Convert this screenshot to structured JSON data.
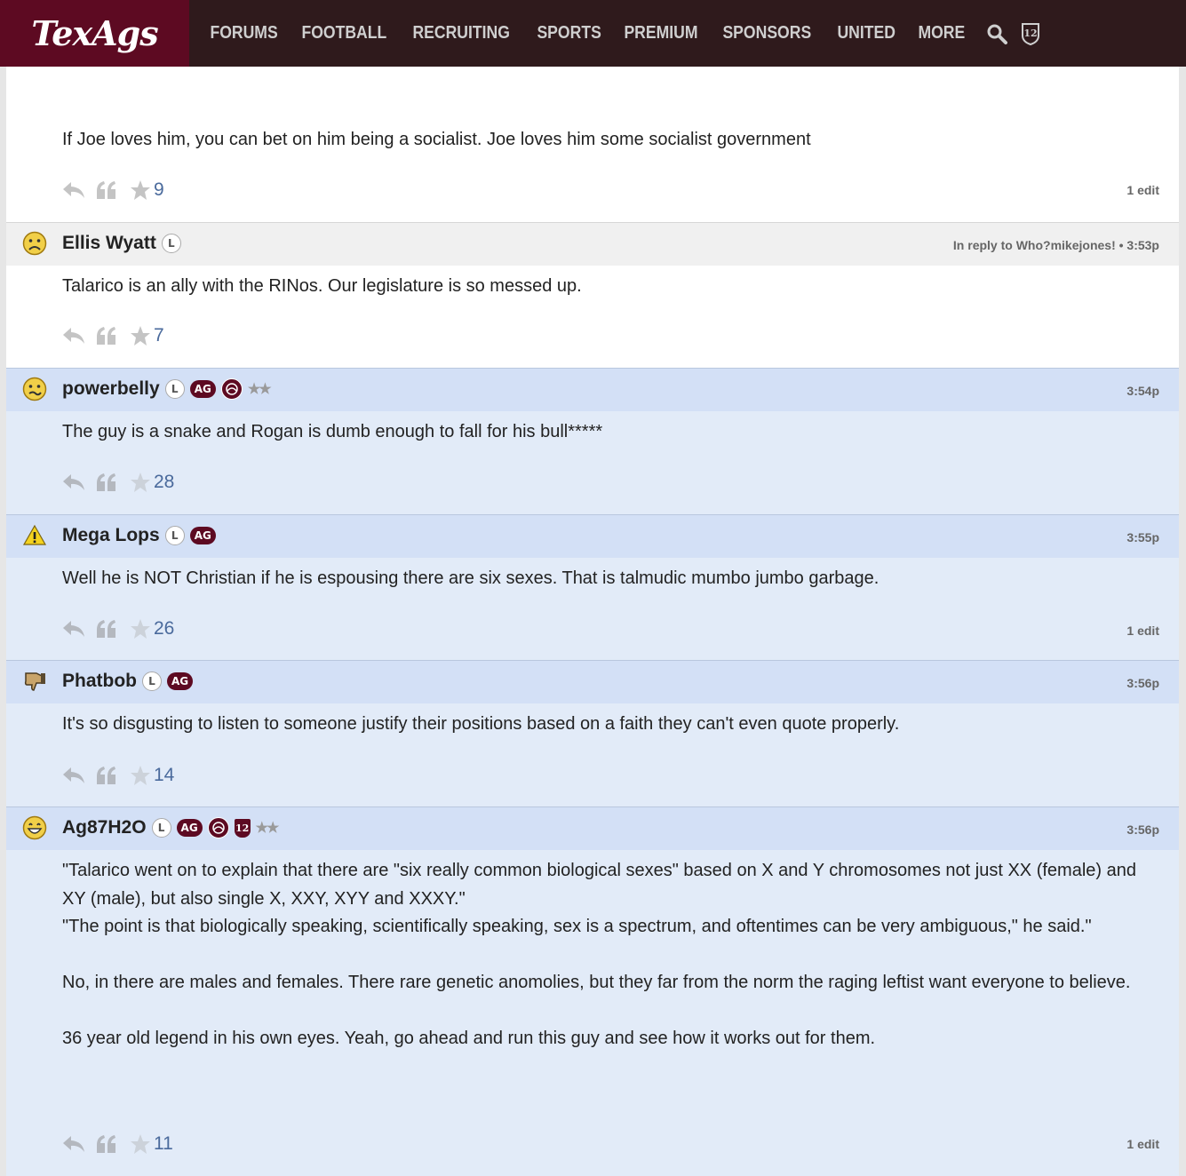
{
  "site": {
    "logo": "TexAgs"
  },
  "nav": {
    "items": [
      "FORUMS",
      "FOOTBALL",
      "RECRUITING",
      "SPORTS",
      "PREMIUM",
      "SPONSORS",
      "UNITED",
      "MORE"
    ],
    "twelfth_man_badge": "12"
  },
  "colors": {
    "maroon": "#5d0a22",
    "nav_bg": "#2f1a1c",
    "blue_post": "#e2ebf8",
    "blue_head": "#d3e0f6"
  },
  "posts": [
    {
      "body": "If Joe loves him, you can bet on him being a socialist. Joe loves him some socialist government",
      "likes": "9",
      "edit": "1 edit"
    },
    {
      "username": "Ellis Wyatt",
      "avatar": "frown-face-icon",
      "badge_l": "L",
      "meta_prefix": "In reply to ",
      "reply_to": "Who?mikejones!",
      "time": " • 3:53p",
      "body": "Talarico is an ally with the RINos. Our legislature is so messed up.",
      "likes": "7"
    },
    {
      "username": "powerbelly",
      "avatar": "confused-face-icon",
      "badge_l": "L",
      "badge_ag": "AG",
      "stars": "★★",
      "time": "3:54p",
      "body": "The guy is a snake and Rogan is dumb enough to fall for his bull*****",
      "likes": "28"
    },
    {
      "username": "Mega Lops",
      "avatar": "warning-icon",
      "badge_l": "L",
      "badge_ag": "AG",
      "time": "3:55p",
      "body": "Well he is NOT Christian if he is espousing there are six sexes. That is talmudic mumbo jumbo garbage.",
      "likes": "26",
      "edit": "1 edit"
    },
    {
      "username": "Phatbob",
      "avatar": "thumbs-down-icon",
      "badge_l": "L",
      "badge_ag": "AG",
      "time": "3:56p",
      "body": "It's so disgusting to listen to someone justify their positions based on a faith they can't even quote properly.",
      "likes": "14"
    },
    {
      "username": "Ag87H2O",
      "avatar": "grin-face-icon",
      "badge_l": "L",
      "badge_ag": "AG",
      "badge_12": "12",
      "stars": "★★",
      "time": "3:56p",
      "body": "\"Talarico went on to explain that there are \"six really common biological sexes\" based on X and Y chromosomes not just XX (female) and XY (male), but also single X, XXY, XYY and XXXY.\"\n\"The point is that biologically speaking, scientifically speaking, sex is a spectrum, and oftentimes can be very ambiguous,\" he said.\"\n\nNo, in there are males and females. There rare genetic anomolies, but they far from the norm the raging leftist want everyone to believe.\n\n36 year old legend in his own eyes. Yeah, go ahead and run this guy and see how it works out for them.",
      "likes": "11",
      "edit": "1 edit"
    }
  ]
}
